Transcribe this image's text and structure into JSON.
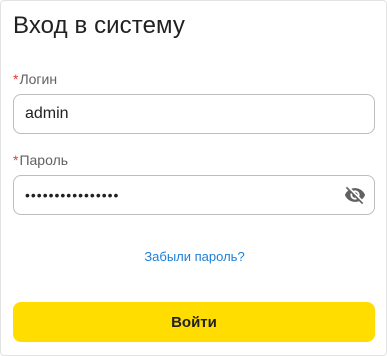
{
  "form": {
    "title": "Вход в систему",
    "required_mark": "*",
    "login": {
      "label": "Логин",
      "value": "admin"
    },
    "password": {
      "label": "Пароль",
      "value": "••••••••••••••••",
      "toggle_icon": "eye-off-icon"
    },
    "forgot_link": "Забыли пароль?",
    "submit_label": "Войти"
  },
  "colors": {
    "accent_button": "#ffdd00",
    "link": "#1e7fd6",
    "required": "#e53935"
  }
}
